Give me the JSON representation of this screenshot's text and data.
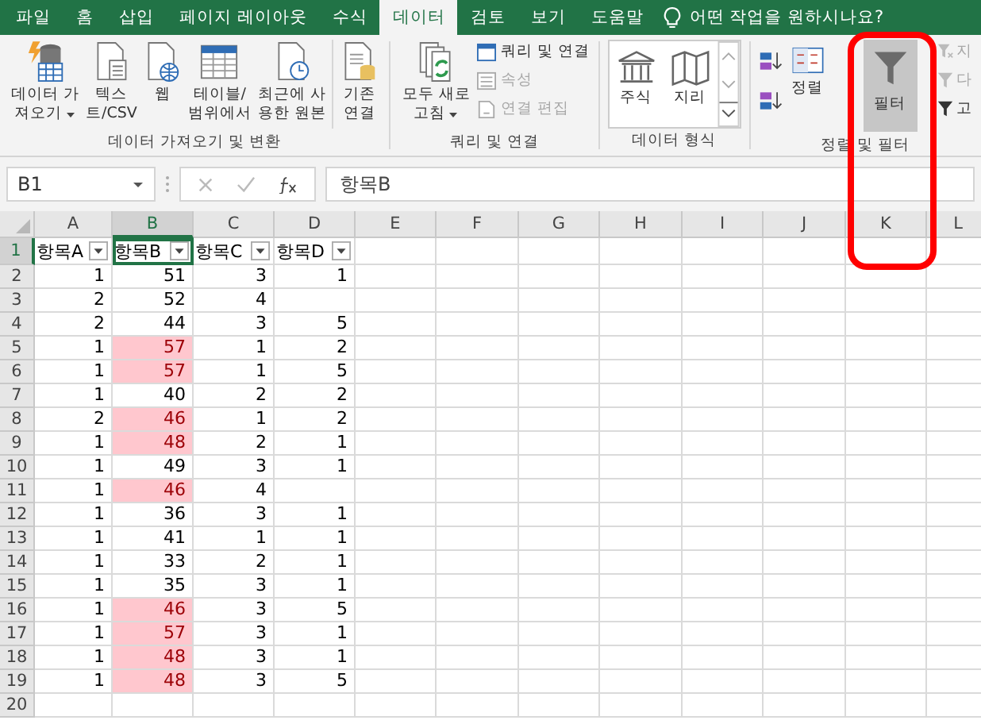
{
  "tabs": [
    {
      "label": "파일",
      "selected": false
    },
    {
      "label": "홈",
      "selected": false
    },
    {
      "label": "삽입",
      "selected": false
    },
    {
      "label": "페이지 레이아웃",
      "selected": false
    },
    {
      "label": "수식",
      "selected": false
    },
    {
      "label": "데이터",
      "selected": true
    },
    {
      "label": "검토",
      "selected": false
    },
    {
      "label": "보기",
      "selected": false
    },
    {
      "label": "도움말",
      "selected": false
    }
  ],
  "tell_me": "어떤 작업을 원하시나요?",
  "ribbon": {
    "get_transform": {
      "label": "데이터 가져오기 및 변환",
      "buttons": [
        {
          "kind": "database",
          "lines": [
            "데이터 가",
            "져오기"
          ],
          "dropdown": true
        },
        {
          "kind": "text-file",
          "lines": [
            "텍스",
            "트/CSV"
          ],
          "dropdown": false
        },
        {
          "kind": "web",
          "lines": [
            "웹"
          ],
          "dropdown": false
        },
        {
          "kind": "table",
          "lines": [
            "테이블/",
            "범위에서"
          ],
          "dropdown": false
        },
        {
          "kind": "recent",
          "lines": [
            "최근에 사",
            "용한 원본"
          ],
          "dropdown": false
        },
        {
          "kind": "connections",
          "lines": [
            "기존",
            "연결"
          ],
          "dropdown": false
        }
      ]
    },
    "queries": {
      "label": "쿼리 및 연결",
      "refresh": {
        "lines": [
          "모두 새로",
          "고침"
        ],
        "dropdown": true
      },
      "items": [
        {
          "kind": "queries",
          "label": "쿼리 및 연결",
          "disabled": false
        },
        {
          "kind": "properties",
          "label": "속성",
          "disabled": true
        },
        {
          "kind": "edit-links",
          "label": "연결 편집",
          "disabled": true
        }
      ]
    },
    "data_types": {
      "label": "데이터 형식",
      "items": [
        {
          "kind": "stocks",
          "label": "주식"
        },
        {
          "kind": "geography",
          "label": "지리"
        }
      ]
    },
    "sort_filter": {
      "label": "정렬 및 필터",
      "sort": "정렬",
      "filter": {
        "label": "필터",
        "selected": true
      },
      "items": [
        {
          "kind": "clear",
          "label": "지",
          "disabled": true
        },
        {
          "kind": "reapply",
          "label": "다",
          "disabled": true
        },
        {
          "kind": "advanced",
          "label": "고",
          "disabled": false
        }
      ]
    }
  },
  "formula_bar": {
    "name_box": "B1",
    "formula": "항목B"
  },
  "columns": [
    {
      "label": "A",
      "selected": false
    },
    {
      "label": "B",
      "selected": true
    },
    {
      "label": "C",
      "selected": false
    },
    {
      "label": "D",
      "selected": false
    },
    {
      "label": "E",
      "selected": false
    },
    {
      "label": "F",
      "selected": false
    },
    {
      "label": "G",
      "selected": false
    },
    {
      "label": "H",
      "selected": false
    },
    {
      "label": "I",
      "selected": false
    },
    {
      "label": "J",
      "selected": false
    },
    {
      "label": "K",
      "selected": false
    },
    {
      "label": "L",
      "selected": false
    }
  ],
  "header_row": {
    "number": "1",
    "selected": true,
    "headers": [
      {
        "label": "항목A",
        "selected": false
      },
      {
        "label": "항목B",
        "selected": true
      },
      {
        "label": "항목C",
        "selected": false
      },
      {
        "label": "항목D",
        "selected": false
      }
    ]
  },
  "rows": [
    {
      "number": "2",
      "cells": [
        "1",
        "51",
        "3",
        "1"
      ],
      "b_highlighted": false
    },
    {
      "number": "3",
      "cells": [
        "2",
        "52",
        "4",
        null
      ],
      "b_highlighted": false
    },
    {
      "number": "4",
      "cells": [
        "2",
        "44",
        "3",
        "5"
      ],
      "b_highlighted": false
    },
    {
      "number": "5",
      "cells": [
        "1",
        "57",
        "1",
        "2"
      ],
      "b_highlighted": true
    },
    {
      "number": "6",
      "cells": [
        "1",
        "57",
        "1",
        "5"
      ],
      "b_highlighted": true
    },
    {
      "number": "7",
      "cells": [
        "1",
        "40",
        "2",
        "2"
      ],
      "b_highlighted": false
    },
    {
      "number": "8",
      "cells": [
        "2",
        "46",
        "1",
        "2"
      ],
      "b_highlighted": true
    },
    {
      "number": "9",
      "cells": [
        "1",
        "48",
        "2",
        "1"
      ],
      "b_highlighted": true
    },
    {
      "number": "10",
      "cells": [
        "1",
        "49",
        "3",
        "1"
      ],
      "b_highlighted": false
    },
    {
      "number": "11",
      "cells": [
        "1",
        "46",
        "4",
        null
      ],
      "b_highlighted": true
    },
    {
      "number": "12",
      "cells": [
        "1",
        "36",
        "3",
        "1"
      ],
      "b_highlighted": false
    },
    {
      "number": "13",
      "cells": [
        "1",
        "41",
        "1",
        "1"
      ],
      "b_highlighted": false
    },
    {
      "number": "14",
      "cells": [
        "1",
        "33",
        "2",
        "1"
      ],
      "b_highlighted": false
    },
    {
      "number": "15",
      "cells": [
        "1",
        "35",
        "3",
        "1"
      ],
      "b_highlighted": false
    },
    {
      "number": "16",
      "cells": [
        "1",
        "46",
        "3",
        "5"
      ],
      "b_highlighted": true
    },
    {
      "number": "17",
      "cells": [
        "1",
        "57",
        "3",
        "1"
      ],
      "b_highlighted": true
    },
    {
      "number": "18",
      "cells": [
        "1",
        "48",
        "3",
        "1"
      ],
      "b_highlighted": true
    },
    {
      "number": "19",
      "cells": [
        "1",
        "48",
        "3",
        "5"
      ],
      "b_highlighted": true
    },
    {
      "number": "20",
      "cells": [
        null,
        null,
        null,
        null
      ],
      "b_highlighted": false
    }
  ]
}
